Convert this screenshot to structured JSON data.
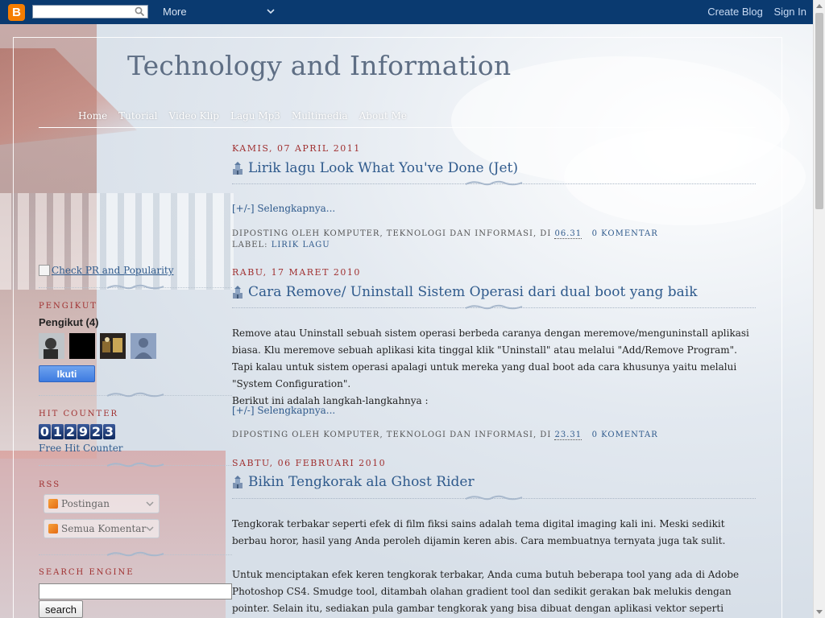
{
  "navbar": {
    "logo_glyph": "B",
    "search_placeholder": "",
    "more_label": "More",
    "create_blog_label": "Create Blog",
    "sign_in_label": "Sign In"
  },
  "header": {
    "title": "Technology and Information",
    "menu": [
      "Home",
      "Tutorial",
      "Video Klip",
      "Lagu Mp3",
      "Multimedia",
      "About Me"
    ]
  },
  "posts": [
    {
      "date": "Kamis, 07 April 2011",
      "title": "Lirik lagu Look What You've Done (Jet)",
      "body": [],
      "readmore": "[+/-] Selengkapnya...",
      "footer_prefix": "Diposting oleh Komputer, Teknologi dan Informasi, di",
      "time": "06.31",
      "comments": "0 komentar",
      "label_prefix": "Label:",
      "label": "Lirik Lagu"
    },
    {
      "date": "Rabu, 17 Maret 2010",
      "title": "Cara Remove/ Uninstall Sistem Operasi dari dual boot yang baik",
      "body": [
        "Remove atau Uninstall sebuah sistem operasi berbeda caranya dengan meremove/menguninstall aplikasi biasa. Klu meremove sebuah aplikasi kita tinggal klik \"Uninstall\" atau melalui \"Add/Remove Program\". Tapi kalau untuk sistem operasi apalagi untuk mereka yang dual boot ada cara khusunya yaitu melalui \"System Configuration\".",
        "Berikut ini adalah langkah-langkahnya :"
      ],
      "readmore": "[+/-] Selengkapnya...",
      "footer_prefix": "Diposting oleh Komputer, Teknologi dan Informasi, di",
      "time": "23.31",
      "comments": "0 komentar"
    },
    {
      "date": "Sabtu, 06 Februari 2010",
      "title": "Bikin Tengkorak ala Ghost Rider",
      "body": [
        "Tengkorak terbakar seperti efek di film fiksi sains adalah tema digital imaging kali ini. Meski sedikit berbau horor, hasil yang Anda peroleh dijamin keren abis. Cara membuatnya ternyata juga tak sulit.",
        "Untuk menciptakan efek keren tengkorak terbakar, Anda cuma butuh beberapa tool yang ada di Adobe Photoshop CS4. Smudge tool, ditambah olahan gradient tool dan sedikit gerakan bak melukis dengan pointer. Selain itu, sediakan pula gambar tengkorak yang bisa dibuat dengan aplikasi vektor seperti CorelDRAW atau Adobe Illustrator. Tak perlu"
      ]
    }
  ],
  "sidebar": {
    "pr_link": "Check PR and Popularity",
    "followers_heading": "Pengikut",
    "followers_label": "Pengikut (4)",
    "follow_button": "Ikuti",
    "hit_counter_heading": "Hit Counter",
    "counter_digits": [
      "0",
      "1",
      "2",
      "9",
      "2",
      "3"
    ],
    "free_counter_link": "Free Hit Counter",
    "rss_heading": "RSS",
    "rss_posts": "Postingan",
    "rss_comments": "Semua Komentar",
    "search_heading": "Search Engine",
    "search_button": "search"
  },
  "colors": {
    "navbar": "#0a3a70",
    "link": "#2f5a8c",
    "date": "#a03030",
    "follow_button": "#3d7be0"
  }
}
